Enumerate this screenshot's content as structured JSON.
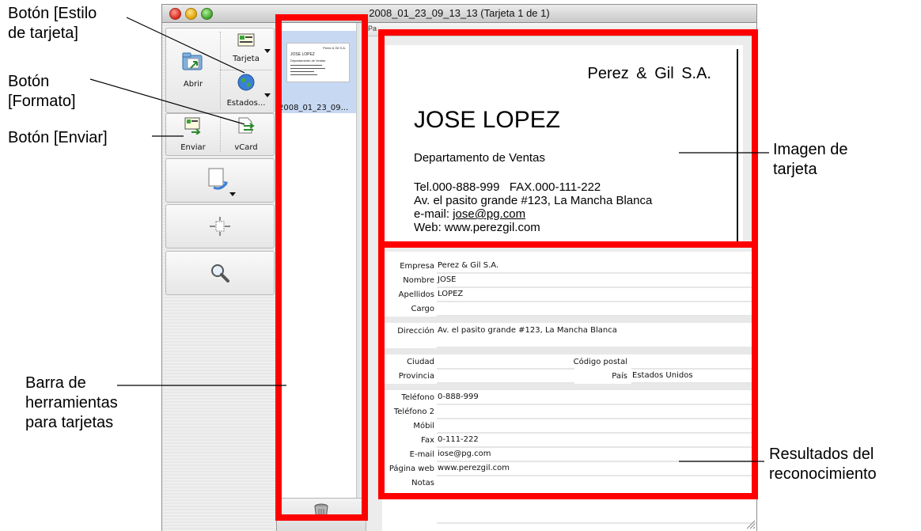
{
  "window": {
    "title": "2008_01_23_09_13_13 (Tarjeta 1 de 1)"
  },
  "callouts": {
    "estilo_tarjeta": "Botón [Estilo\nde tarjeta]",
    "formato": "Botón\n[Formato]",
    "enviar": "Botón [Enviar]",
    "barra": "Barra de\nherramientas\npara tarjetas",
    "imagen": "Imagen de\ntarjeta",
    "resultados": "Resultados del\nreconocimiento"
  },
  "toolbar": {
    "abrir": "Abrir",
    "tarjeta": "Tarjeta",
    "estados": "Estados...",
    "enviar": "Enviar",
    "vcard": "vCard"
  },
  "thumbnail": {
    "name": "2008_01_23_09...",
    "card_company": "Perez & Gil S.A.",
    "card_name": "JOSE LOPEZ",
    "card_dept": "Departamento de Ventas"
  },
  "tabstrip": {
    "text": "Pa"
  },
  "card": {
    "company": "Perez & Gil S.A.",
    "name": "JOSE LOPEZ",
    "department": "Departamento de Ventas",
    "phone_fax": "Tel.000-888-999   FAX.000-111-222",
    "address": "Av. el pasito grande #123, La Mancha Blanca",
    "email_label": "e-mail: ",
    "email": "jose@pg.com",
    "web": "Web: www.perezgil.com"
  },
  "form": {
    "empresa": {
      "label": "Empresa",
      "value": "Perez & Gil S.A."
    },
    "nombre": {
      "label": "Nombre",
      "value": "JOSE"
    },
    "apellidos": {
      "label": "Apellidos",
      "value": "LOPEZ"
    },
    "cargo": {
      "label": "Cargo",
      "value": ""
    },
    "direccion": {
      "label": "Dirección",
      "value": "Av. el pasito grande #123, La Mancha Blanca"
    },
    "ciudad": {
      "label": "Ciudad",
      "value": ""
    },
    "codigo_postal": {
      "label": "Código postal",
      "value": ""
    },
    "provincia": {
      "label": "Provincia",
      "value": ""
    },
    "pais": {
      "label": "País",
      "value": "Estados Unidos"
    },
    "telefono": {
      "label": "Teléfono",
      "value": "0-888-999"
    },
    "telefono2": {
      "label": "Teléfono 2",
      "value": ""
    },
    "movil": {
      "label": "Móbil",
      "value": ""
    },
    "fax": {
      "label": "Fax",
      "value": "0-111-222"
    },
    "email": {
      "label": "E-mail",
      "value": "iose@pg.com"
    },
    "web": {
      "label": "Página web",
      "value": "www.perezgil.com"
    },
    "notas": {
      "label": "Notas",
      "value": ""
    }
  },
  "colors": {
    "highlight": "#ff0000",
    "selection": "#c7d8f2"
  }
}
